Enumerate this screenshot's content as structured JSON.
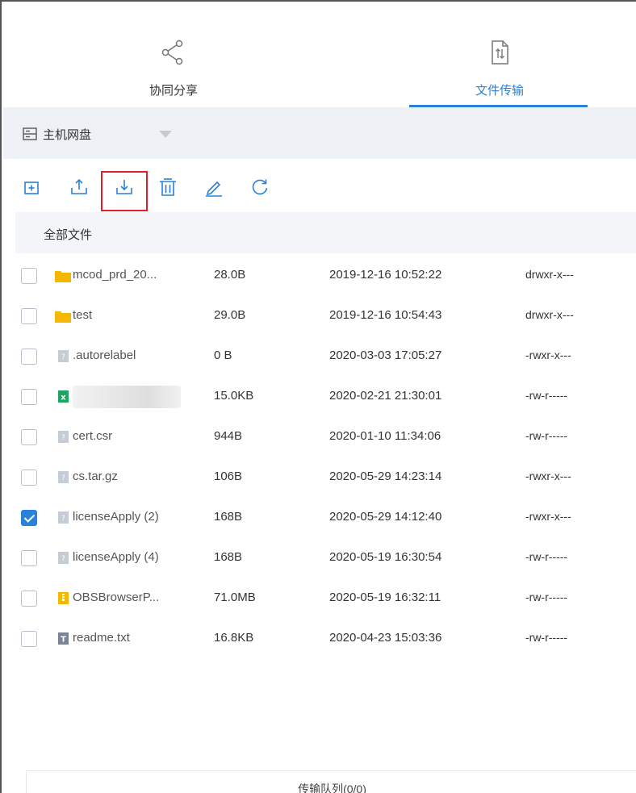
{
  "tabs": [
    {
      "label": "协同分享",
      "icon": "share-icon",
      "active": false
    },
    {
      "label": "文件传输",
      "icon": "file-transfer-icon",
      "active": true
    }
  ],
  "disk": {
    "label": "主机网盘",
    "icon": "disk-icon"
  },
  "toolbar": {
    "tools": [
      "new-folder-icon",
      "upload-icon",
      "download-icon",
      "delete-icon",
      "rename-icon",
      "refresh-icon"
    ],
    "accent": "#2a81d9",
    "highlight_color": "#e0202a"
  },
  "breadcrumb": {
    "label": "全部文件"
  },
  "files": [
    {
      "name": "mcod_prd_20...",
      "size": "28.0B",
      "date": "2019-12-16 10:52:22",
      "perm": "drwxr-x---",
      "type": "folder",
      "checked": false
    },
    {
      "name": "test",
      "size": "29.0B",
      "date": "2019-12-16 10:54:43",
      "perm": "drwxr-x---",
      "type": "folder",
      "checked": false
    },
    {
      "name": ".autorelabel",
      "size": "0 B",
      "date": "2020-03-03 17:05:27",
      "perm": "-rwxr-x---",
      "type": "unknown",
      "checked": false
    },
    {
      "name": "",
      "size": "15.0KB",
      "date": "2020-02-21 21:30:01",
      "perm": "-rw-r-----",
      "type": "excel",
      "checked": false
    },
    {
      "name": "cert.csr",
      "size": "944B",
      "date": "2020-01-10 11:34:06",
      "perm": "-rw-r-----",
      "type": "unknown",
      "checked": false
    },
    {
      "name": "cs.tar.gz",
      "size": "106B",
      "date": "2020-05-29 14:23:14",
      "perm": "-rwxr-x---",
      "type": "unknown",
      "checked": false
    },
    {
      "name": "licenseApply (2)",
      "size": "168B",
      "date": "2020-05-29 14:12:40",
      "perm": "-rwxr-x---",
      "type": "unknown",
      "checked": true
    },
    {
      "name": "licenseApply (4)",
      "size": "168B",
      "date": "2020-05-19 16:30:54",
      "perm": "-rw-r-----",
      "type": "unknown",
      "checked": false
    },
    {
      "name": "OBSBrowserP...",
      "size": "71.0MB",
      "date": "2020-05-19 16:32:11",
      "perm": "-rw-r-----",
      "type": "archive",
      "checked": false
    },
    {
      "name": "readme.txt",
      "size": "16.8KB",
      "date": "2020-04-23 15:03:36",
      "perm": "-rw-r-----",
      "type": "text",
      "checked": false
    }
  ],
  "queue": {
    "label": "传输队列(0/0)"
  }
}
